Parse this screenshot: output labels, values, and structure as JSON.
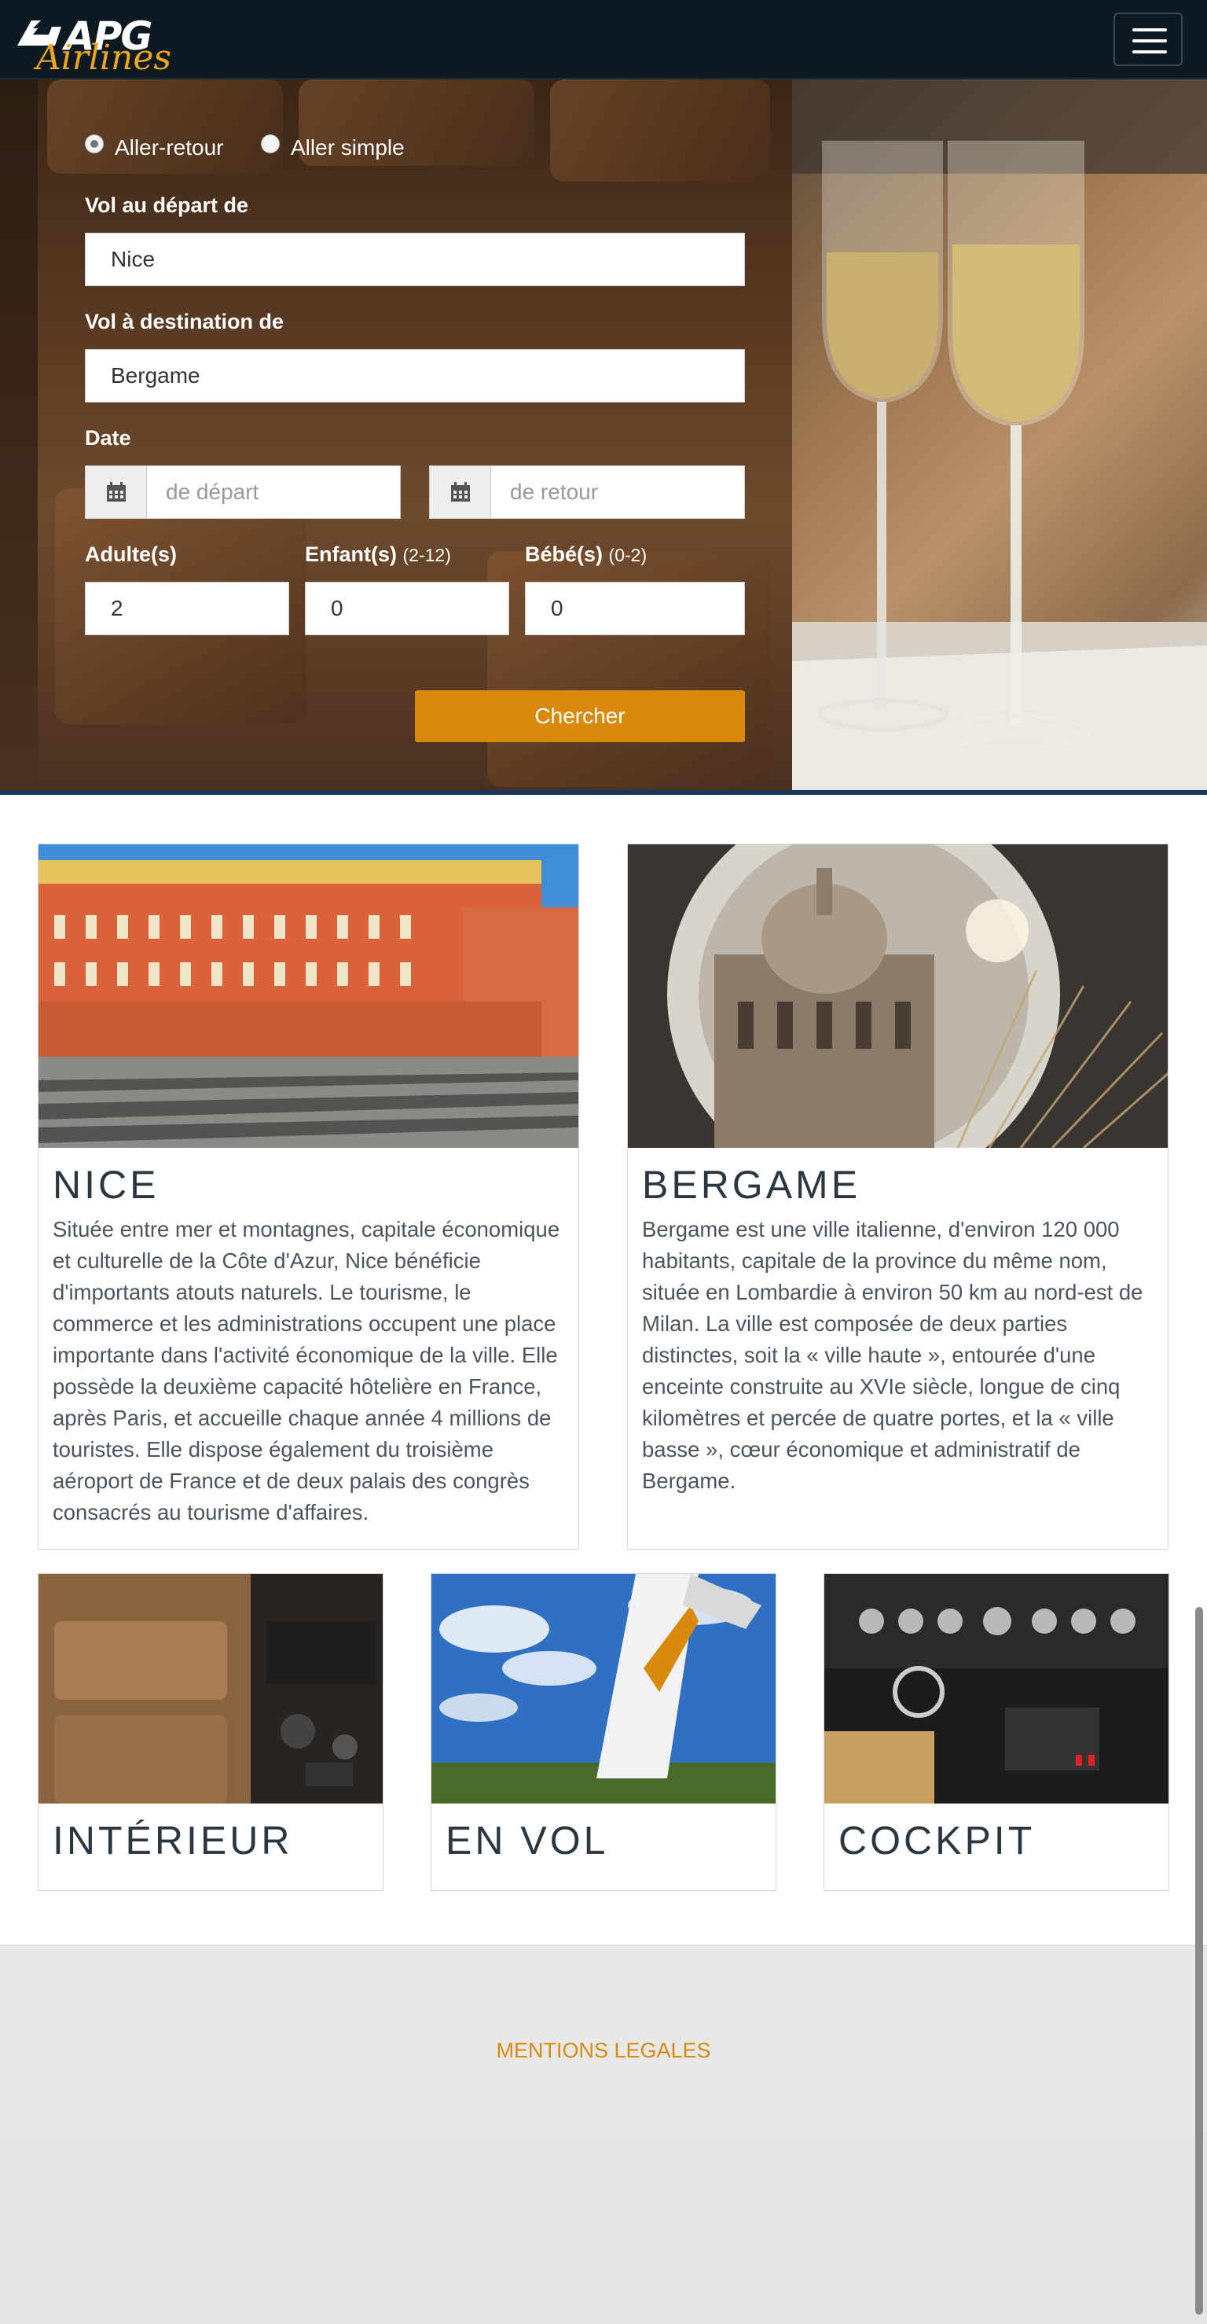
{
  "nav": {
    "logo_apg": "APG",
    "logo_airlines": "Airlines"
  },
  "search": {
    "trip_types": [
      "Aller-retour",
      "Aller simple"
    ],
    "selected_trip": "Aller-retour",
    "from_label": "Vol au départ de",
    "from_value": "Nice",
    "to_label": "Vol à destination de",
    "to_value": "Bergame",
    "date_label": "Date",
    "depart_placeholder": "de départ",
    "return_placeholder": "de retour",
    "adults_label": "Adulte(s)",
    "adults_value": "2",
    "children_label": "Enfant(s)",
    "children_range": "(2-12)",
    "children_value": "0",
    "babies_label": "Bébé(s)",
    "babies_range": "(0-2)",
    "babies_value": "0",
    "search_button": "Chercher"
  },
  "destinations": [
    {
      "title": "NICE",
      "text": "Située entre mer et montagnes, capitale économique et culturelle de la Côte d'Azur, Nice bénéficie d'importants atouts naturels. Le tourisme, le commerce et les administrations occupent une place importante dans l'activité économique de la ville. Elle possède la deuxième capacité hôtelière en France, après Paris, et accueille chaque année 4 millions de touristes. Elle dispose également du troisième aéroport de France et de deux palais des congrès consacrés au tourisme d'affaires."
    },
    {
      "title": "BERGAME",
      "text": "Bergame est une ville italienne, d'environ 120 000 habitants, capitale de la province du même nom, située en Lombardie à environ 50 km au nord-est de Milan. La ville est composée de deux parties distinctes, soit la « ville haute », entourée d'une enceinte construite au XVIe siècle, longue de cinq kilomètres et percée de quatre portes, et la « ville basse », cœur économique et administratif de Bergame."
    }
  ],
  "gallery": [
    {
      "title": "INTÉRIEUR"
    },
    {
      "title": "EN VOL"
    },
    {
      "title": "COCKPIT"
    }
  ],
  "footer": {
    "legal_link": "MENTIONS LEGALES"
  },
  "colors": {
    "accent": "#d98a0c",
    "navbar": "#0c1a22",
    "logo_gold": "#f2a51a"
  }
}
